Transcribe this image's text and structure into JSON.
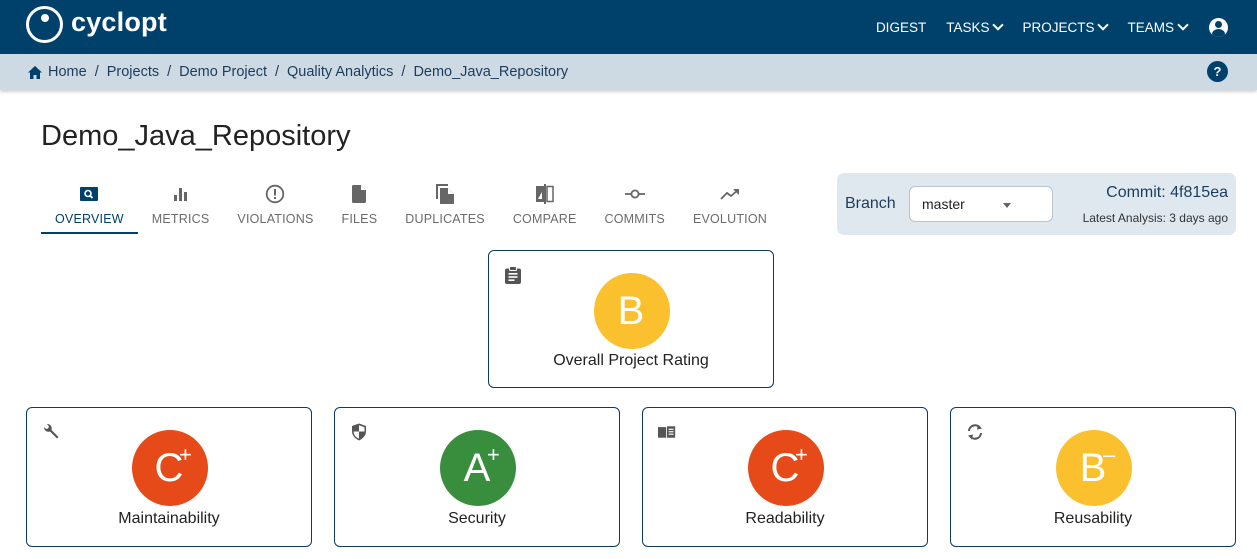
{
  "app": {
    "name": "cyclopt"
  },
  "nav": {
    "items": [
      {
        "label": "DIGEST",
        "dropdown": false
      },
      {
        "label": "TASKS",
        "dropdown": true
      },
      {
        "label": "PROJECTS",
        "dropdown": true
      },
      {
        "label": "TEAMS",
        "dropdown": true
      }
    ],
    "user_icon": "account-circle-icon"
  },
  "breadcrumb": {
    "items": [
      "Home",
      "Projects",
      "Demo Project",
      "Quality Analytics",
      "Demo_Java_Repository"
    ],
    "separator": "/",
    "help_label": "?"
  },
  "page": {
    "title": "Demo_Java_Repository"
  },
  "tabs": [
    {
      "label": "OVERVIEW",
      "icon": "search-icon",
      "active": true
    },
    {
      "label": "METRICS",
      "icon": "bar-chart-icon",
      "active": false
    },
    {
      "label": "VIOLATIONS",
      "icon": "alert-circle-icon",
      "active": false
    },
    {
      "label": "FILES",
      "icon": "file-icon",
      "active": false
    },
    {
      "label": "DUPLICATES",
      "icon": "copy-icon",
      "active": false
    },
    {
      "label": "COMPARE",
      "icon": "compare-icon",
      "active": false
    },
    {
      "label": "COMMITS",
      "icon": "commit-icon",
      "active": false
    },
    {
      "label": "EVOLUTION",
      "icon": "trending-up-icon",
      "active": false
    }
  ],
  "branch": {
    "label": "Branch",
    "selected": "master",
    "commit_label": "Commit:",
    "commit_hash": "4f815ea",
    "latest_analysis": "Latest Analysis: 3 days ago"
  },
  "ratings": {
    "overall": {
      "label": "Overall Project Rating",
      "grade": "B",
      "modifier": "",
      "color": "#fbc02d",
      "icon": "clipboard-icon"
    },
    "categories": [
      {
        "label": "Maintainability",
        "grade": "C",
        "modifier": "+",
        "color": "#e64a19",
        "icon": "wrench-icon"
      },
      {
        "label": "Security",
        "grade": "A",
        "modifier": "+",
        "color": "#388e3c",
        "icon": "shield-icon"
      },
      {
        "label": "Readability",
        "grade": "C",
        "modifier": "+",
        "color": "#e64a19",
        "icon": "book-icon"
      },
      {
        "label": "Reusability",
        "grade": "B",
        "modifier": "–",
        "color": "#fbc02d",
        "icon": "sync-icon"
      }
    ]
  }
}
